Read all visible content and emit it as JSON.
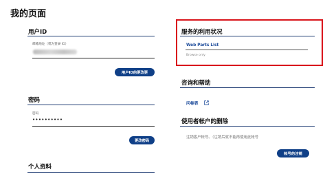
{
  "page_title": "我的页面",
  "user_id": {
    "title": "用户ID",
    "field_label": "邮箱地址（或为登录 ID）",
    "button": "用户ID的更改更"
  },
  "password": {
    "title": "密码",
    "field_label": "密码",
    "masked_value": "••••••••••",
    "button": "更改密码"
  },
  "personal": {
    "title": "个人资料"
  },
  "service": {
    "title": "服务的利用状况",
    "link": "Web Parts List",
    "sub": "Browse only"
  },
  "contact": {
    "title": "咨询和帮助",
    "link": "问卷表"
  },
  "delete": {
    "title": "使用者帐户的删除",
    "desc": "注销客户帐号。（注销后就不能再使用此帐号",
    "button": "帐号的注销"
  },
  "colors": {
    "accent": "#0f3f87",
    "highlight_border": "#d9151c",
    "link": "#1b4a9a"
  }
}
